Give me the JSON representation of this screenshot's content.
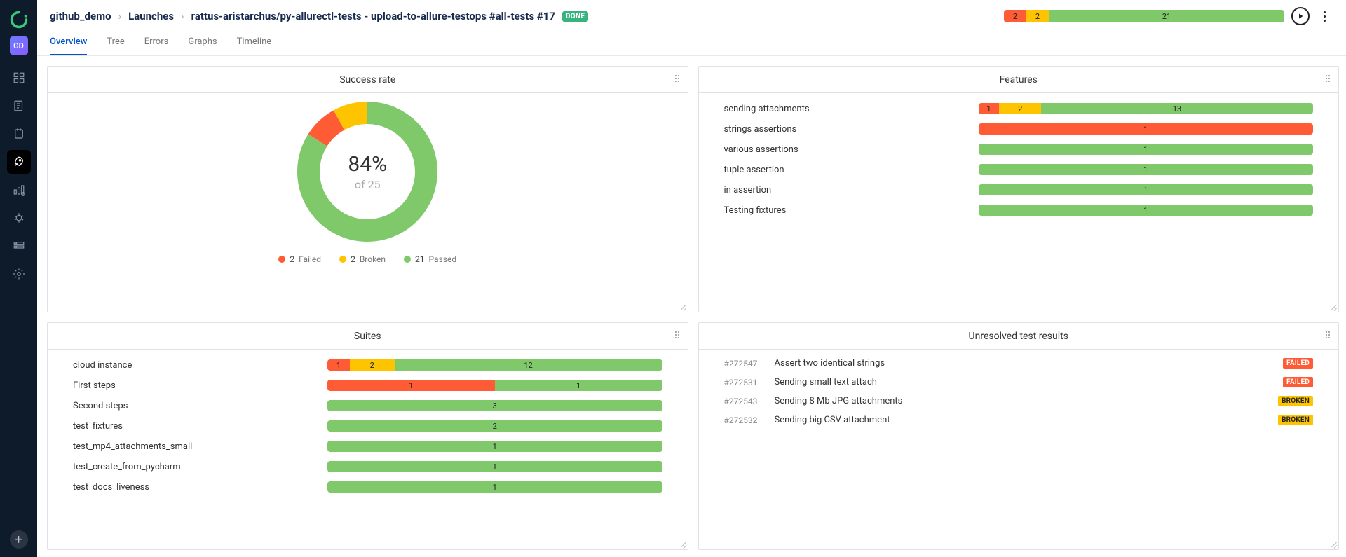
{
  "sidebar": {
    "avatar": "GD"
  },
  "header": {
    "breadcrumb": [
      "github_demo",
      "Launches",
      "rattus-aristarchus/py-allurectl-tests - upload-to-allure-testops #all-tests #17"
    ],
    "status_badge": "DONE",
    "top_bar": {
      "failed": 2,
      "broken": 2,
      "passed": 21
    }
  },
  "tabs": [
    "Overview",
    "Tree",
    "Errors",
    "Graphs",
    "Timeline"
  ],
  "active_tab": 0,
  "colors": {
    "fail": "#ff5c35",
    "broken": "#ffc400",
    "pass": "#7fc96b"
  },
  "cards": {
    "success_rate": {
      "title": "Success rate",
      "percent": "84%",
      "of_label": "of 25",
      "legend": [
        {
          "count": 2,
          "label": "Failed",
          "color": "#ff5c35"
        },
        {
          "count": 2,
          "label": "Broken",
          "color": "#ffc400"
        },
        {
          "count": 21,
          "label": "Passed",
          "color": "#7fc96b"
        }
      ]
    },
    "features": {
      "title": "Features",
      "rows": [
        {
          "label": "sending attachments",
          "segments": [
            {
              "v": 1,
              "c": "fail"
            },
            {
              "v": 2,
              "c": "broken"
            },
            {
              "v": 13,
              "c": "pass"
            }
          ]
        },
        {
          "label": "strings assertions",
          "segments": [
            {
              "v": 1,
              "c": "fail"
            }
          ]
        },
        {
          "label": "various assertions",
          "segments": [
            {
              "v": 1,
              "c": "pass"
            }
          ]
        },
        {
          "label": "tuple assertion",
          "segments": [
            {
              "v": 1,
              "c": "pass"
            }
          ]
        },
        {
          "label": "in assertion",
          "segments": [
            {
              "v": 1,
              "c": "pass"
            }
          ]
        },
        {
          "label": "Testing fixtures",
          "segments": [
            {
              "v": 1,
              "c": "pass"
            }
          ]
        }
      ]
    },
    "suites": {
      "title": "Suites",
      "rows": [
        {
          "label": "cloud instance",
          "segments": [
            {
              "v": 1,
              "c": "fail"
            },
            {
              "v": 2,
              "c": "broken"
            },
            {
              "v": 12,
              "c": "pass"
            }
          ]
        },
        {
          "label": "First steps",
          "segments": [
            {
              "v": 1,
              "c": "fail"
            },
            {
              "v": 1,
              "c": "pass"
            }
          ]
        },
        {
          "label": "Second steps",
          "segments": [
            {
              "v": 3,
              "c": "pass"
            }
          ]
        },
        {
          "label": "test_fixtures",
          "segments": [
            {
              "v": 2,
              "c": "pass"
            }
          ]
        },
        {
          "label": "test_mp4_attachments_small",
          "segments": [
            {
              "v": 1,
              "c": "pass"
            }
          ]
        },
        {
          "label": "test_create_from_pycharm",
          "segments": [
            {
              "v": 1,
              "c": "pass"
            }
          ]
        },
        {
          "label": "test_docs_liveness",
          "segments": [
            {
              "v": 1,
              "c": "pass"
            }
          ]
        }
      ]
    },
    "unresolved": {
      "title": "Unresolved test results",
      "items": [
        {
          "id": "#272547",
          "name": "Assert two identical strings",
          "status": "FAILED"
        },
        {
          "id": "#272531",
          "name": "Sending small text attach",
          "status": "FAILED"
        },
        {
          "id": "#272543",
          "name": "Sending 8 Mb JPG attachments",
          "status": "BROKEN"
        },
        {
          "id": "#272532",
          "name": "Sending big CSV attachment",
          "status": "BROKEN"
        }
      ]
    }
  },
  "chart_data": {
    "type": "pie",
    "title": "Success rate",
    "categories": [
      "Failed",
      "Broken",
      "Passed"
    ],
    "values": [
      2,
      2,
      21
    ],
    "total": 25,
    "percent_passed": 84
  }
}
